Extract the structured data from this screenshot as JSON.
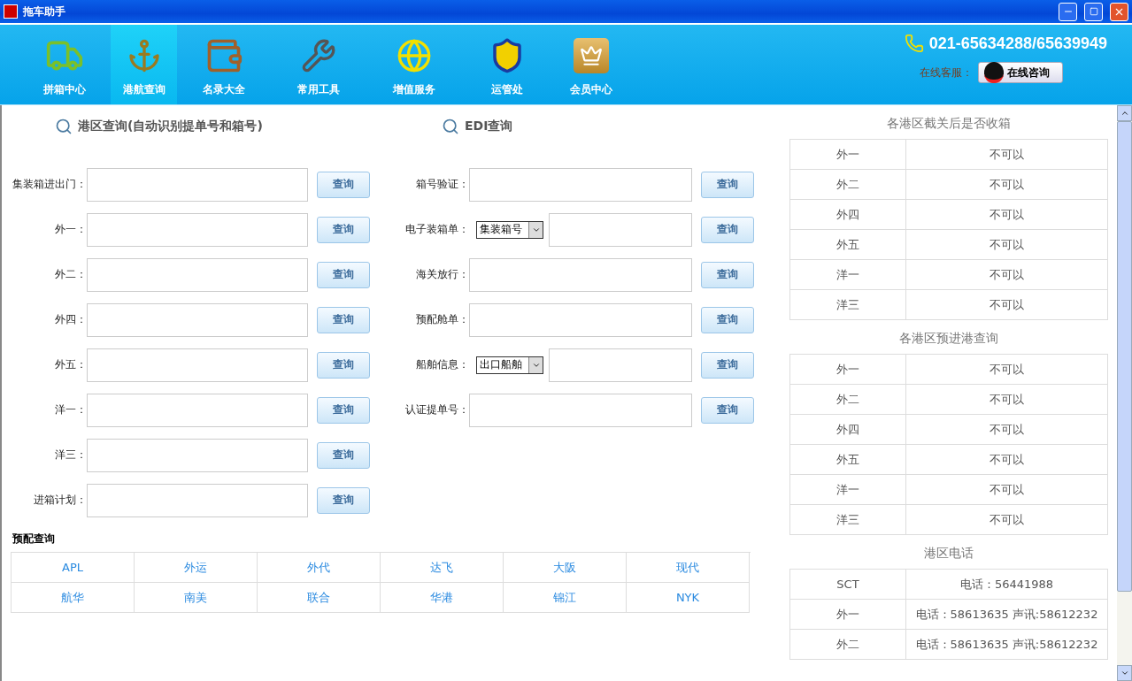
{
  "window": {
    "title": "拖车助手"
  },
  "nav": {
    "items": [
      {
        "label": "拼箱中心",
        "selected": false
      },
      {
        "label": "港航查询",
        "selected": true
      },
      {
        "label": "名录大全",
        "selected": false
      },
      {
        "label": "常用工具",
        "selected": false
      },
      {
        "label": "增值服务",
        "selected": false
      },
      {
        "label": "运管处",
        "selected": false
      },
      {
        "label": "会员中心",
        "selected": false
      }
    ],
    "hotline": "021-65634288/65639949",
    "service_label": "在线客服：",
    "service_button": "在线咨询"
  },
  "port_query": {
    "title": "港区查询(自动识别提单号和箱号)",
    "rows": [
      {
        "label": "集装箱进出门：",
        "button": "查询"
      },
      {
        "label": "外一：",
        "button": "查询"
      },
      {
        "label": "外二：",
        "button": "查询"
      },
      {
        "label": "外四：",
        "button": "查询"
      },
      {
        "label": "外五：",
        "button": "查询"
      },
      {
        "label": "洋一：",
        "button": "查询"
      },
      {
        "label": "洋三：",
        "button": "查询"
      },
      {
        "label": "进箱计划：",
        "button": "查询"
      }
    ]
  },
  "edi_query": {
    "title": "EDI查询",
    "rows": [
      {
        "label": "箱号验证：",
        "button": "查询"
      },
      {
        "label": "电子装箱单：",
        "select": "集装箱号",
        "button": "查询"
      },
      {
        "label": "海关放行：",
        "button": "查询"
      },
      {
        "label": "预配舱单：",
        "button": "查询"
      },
      {
        "label": "船舶信息：",
        "select": "出口船舶",
        "button": "查询"
      },
      {
        "label": "认证提单号：",
        "button": "查询"
      }
    ]
  },
  "preassign": {
    "title": "预配查询",
    "rows": [
      [
        "APL",
        "外运",
        "外代",
        "达飞",
        "大阪",
        "现代"
      ],
      [
        "航华",
        "南美",
        "联合",
        "华港",
        "锦江",
        "NYK"
      ]
    ]
  },
  "side_sections": [
    {
      "title": "各港区截关后是否收箱",
      "rows": [
        {
          "port": "外一",
          "value": "不可以"
        },
        {
          "port": "外二",
          "value": "不可以"
        },
        {
          "port": "外四",
          "value": "不可以"
        },
        {
          "port": "外五",
          "value": "不可以"
        },
        {
          "port": "洋一",
          "value": "不可以"
        },
        {
          "port": "洋三",
          "value": "不可以"
        }
      ]
    },
    {
      "title": "各港区预进港查询",
      "rows": [
        {
          "port": "外一",
          "value": "不可以"
        },
        {
          "port": "外二",
          "value": "不可以"
        },
        {
          "port": "外四",
          "value": "不可以"
        },
        {
          "port": "外五",
          "value": "不可以"
        },
        {
          "port": "洋一",
          "value": "不可以"
        },
        {
          "port": "洋三",
          "value": "不可以"
        }
      ]
    },
    {
      "title": "港区电话",
      "rows": [
        {
          "port": "SCT",
          "value": "电话：56441988"
        },
        {
          "port": "外一",
          "value": "电话：58613635 声讯:58612232"
        },
        {
          "port": "外二",
          "value": "电话：58613635 声讯:58612232"
        }
      ]
    }
  ]
}
